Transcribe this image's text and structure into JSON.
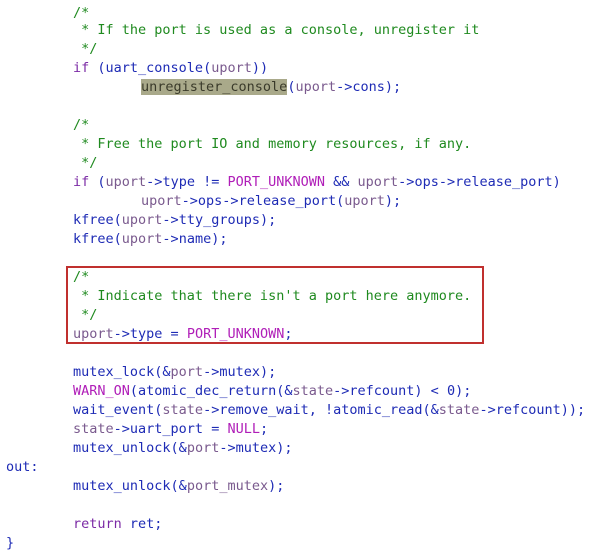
{
  "editor": {
    "lines": [
      [
        {
          "t": "/*",
          "c": "comment"
        }
      ],
      [
        {
          "t": " * If the port is used as a console, unregister it",
          "c": "comment"
        }
      ],
      [
        {
          "t": " */",
          "c": "comment"
        }
      ],
      [
        {
          "t": "if",
          "c": "keyword"
        },
        {
          "t": " (",
          "c": "plain"
        },
        {
          "t": "uart_console",
          "c": "func"
        },
        {
          "t": "(",
          "c": "plain"
        },
        {
          "t": "uport",
          "c": "var"
        },
        {
          "t": "))",
          "c": "plain"
        }
      ],
      [
        {
          "t": "unregister_console",
          "c": "func",
          "hl": true
        },
        {
          "t": "(",
          "c": "plain"
        },
        {
          "t": "uport",
          "c": "var"
        },
        {
          "t": "->",
          "c": "op"
        },
        {
          "t": "cons",
          "c": "member"
        },
        {
          "t": ");",
          "c": "plain"
        }
      ],
      [],
      [
        {
          "t": "/*",
          "c": "comment"
        }
      ],
      [
        {
          "t": " * Free the port IO and memory resources, if any.",
          "c": "comment"
        }
      ],
      [
        {
          "t": " */",
          "c": "comment"
        }
      ],
      [
        {
          "t": "if",
          "c": "keyword"
        },
        {
          "t": " (",
          "c": "plain"
        },
        {
          "t": "uport",
          "c": "var"
        },
        {
          "t": "->",
          "c": "op"
        },
        {
          "t": "type",
          "c": "member"
        },
        {
          "t": " != ",
          "c": "plain"
        },
        {
          "t": "PORT_UNKNOWN",
          "c": "const"
        },
        {
          "t": " && ",
          "c": "plain"
        },
        {
          "t": "uport",
          "c": "var"
        },
        {
          "t": "->",
          "c": "op"
        },
        {
          "t": "ops",
          "c": "member"
        },
        {
          "t": "->",
          "c": "op"
        },
        {
          "t": "release_port",
          "c": "member"
        },
        {
          "t": ")",
          "c": "plain"
        }
      ],
      [
        {
          "t": "uport",
          "c": "var"
        },
        {
          "t": "->",
          "c": "op"
        },
        {
          "t": "ops",
          "c": "member"
        },
        {
          "t": "->",
          "c": "op"
        },
        {
          "t": "release_port",
          "c": "member"
        },
        {
          "t": "(",
          "c": "plain"
        },
        {
          "t": "uport",
          "c": "var"
        },
        {
          "t": ");",
          "c": "plain"
        }
      ],
      [
        {
          "t": "kfree",
          "c": "func"
        },
        {
          "t": "(",
          "c": "plain"
        },
        {
          "t": "uport",
          "c": "var"
        },
        {
          "t": "->",
          "c": "op"
        },
        {
          "t": "tty_groups",
          "c": "member"
        },
        {
          "t": ");",
          "c": "plain"
        }
      ],
      [
        {
          "t": "kfree",
          "c": "func"
        },
        {
          "t": "(",
          "c": "plain"
        },
        {
          "t": "uport",
          "c": "var"
        },
        {
          "t": "->",
          "c": "op"
        },
        {
          "t": "name",
          "c": "member"
        },
        {
          "t": ");",
          "c": "plain"
        }
      ],
      [],
      [
        {
          "t": "/*",
          "c": "comment"
        }
      ],
      [
        {
          "t": " * Indicate that there isn't a port here anymore.",
          "c": "comment"
        }
      ],
      [
        {
          "t": " */",
          "c": "comment"
        }
      ],
      [
        {
          "t": "uport",
          "c": "var"
        },
        {
          "t": "->",
          "c": "op"
        },
        {
          "t": "type",
          "c": "member"
        },
        {
          "t": " = ",
          "c": "plain"
        },
        {
          "t": "PORT_UNKNOWN",
          "c": "const"
        },
        {
          "t": ";",
          "c": "plain"
        }
      ],
      [],
      [
        {
          "t": "mutex_lock",
          "c": "func"
        },
        {
          "t": "(&",
          "c": "plain"
        },
        {
          "t": "port",
          "c": "var"
        },
        {
          "t": "->",
          "c": "op"
        },
        {
          "t": "mutex",
          "c": "member"
        },
        {
          "t": ");",
          "c": "plain"
        }
      ],
      [
        {
          "t": "WARN_ON",
          "c": "const"
        },
        {
          "t": "(",
          "c": "plain"
        },
        {
          "t": "atomic_dec_return",
          "c": "func"
        },
        {
          "t": "(&",
          "c": "plain"
        },
        {
          "t": "state",
          "c": "var"
        },
        {
          "t": "->",
          "c": "op"
        },
        {
          "t": "refcount",
          "c": "member"
        },
        {
          "t": ") < ",
          "c": "plain"
        },
        {
          "t": "0",
          "c": "number"
        },
        {
          "t": ");",
          "c": "plain"
        }
      ],
      [
        {
          "t": "wait_event",
          "c": "func"
        },
        {
          "t": "(",
          "c": "plain"
        },
        {
          "t": "state",
          "c": "var"
        },
        {
          "t": "->",
          "c": "op"
        },
        {
          "t": "remove_wait",
          "c": "member"
        },
        {
          "t": ", !",
          "c": "plain"
        },
        {
          "t": "atomic_read",
          "c": "func"
        },
        {
          "t": "(&",
          "c": "plain"
        },
        {
          "t": "state",
          "c": "var"
        },
        {
          "t": "->",
          "c": "op"
        },
        {
          "t": "refcount",
          "c": "member"
        },
        {
          "t": "));",
          "c": "plain"
        }
      ],
      [
        {
          "t": "state",
          "c": "var"
        },
        {
          "t": "->",
          "c": "op"
        },
        {
          "t": "uart_port",
          "c": "member"
        },
        {
          "t": " = ",
          "c": "plain"
        },
        {
          "t": "NULL",
          "c": "const"
        },
        {
          "t": ";",
          "c": "plain"
        }
      ],
      [
        {
          "t": "mutex_unlock",
          "c": "func"
        },
        {
          "t": "(&",
          "c": "plain"
        },
        {
          "t": "port",
          "c": "var"
        },
        {
          "t": "->",
          "c": "op"
        },
        {
          "t": "mutex",
          "c": "member"
        },
        {
          "t": ");",
          "c": "plain"
        }
      ],
      [
        {
          "t": "out:",
          "c": "label"
        }
      ],
      [
        {
          "t": "mutex_unlock",
          "c": "func"
        },
        {
          "t": "(&",
          "c": "plain"
        },
        {
          "t": "port_mutex",
          "c": "var"
        },
        {
          "t": ");",
          "c": "plain"
        }
      ],
      [],
      [
        {
          "t": "return",
          "c": "keyword"
        },
        {
          "t": " ret;",
          "c": "plain"
        }
      ],
      [
        {
          "t": "}",
          "c": "plain"
        }
      ]
    ],
    "highlight_box_color": "#c0302e",
    "selection_color": "#a9a98a"
  }
}
